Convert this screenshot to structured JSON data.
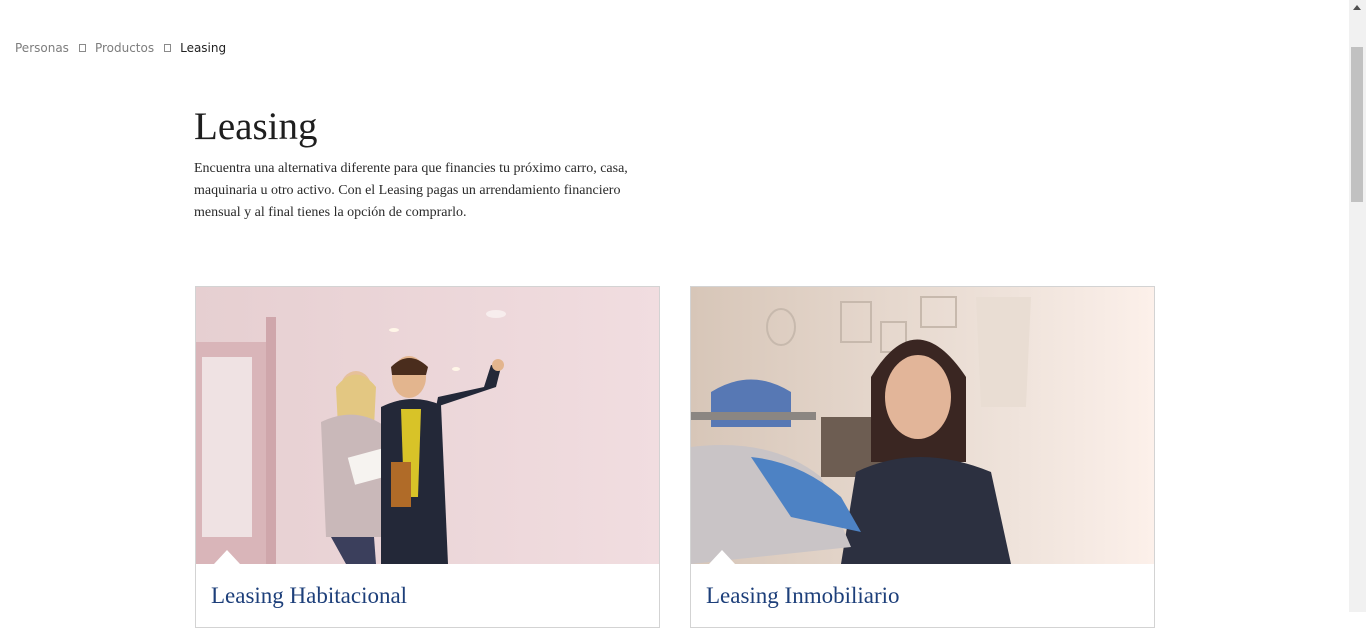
{
  "breadcrumb": {
    "items": [
      "Personas",
      "Productos"
    ],
    "current": "Leasing"
  },
  "header": {
    "title": "Leasing",
    "description": "Encuentra una alternativa diferente para que financies tu próximo carro, casa, maquinaria u otro activo. Con el Leasing pagas un arrendamiento financiero mensual y al final tienes la opción de comprarlo."
  },
  "cards": [
    {
      "title": "Leasing Habitacional",
      "image": "couple-viewing-house-photo"
    },
    {
      "title": "Leasing Inmobiliario",
      "image": "woman-in-shop-photo"
    }
  ],
  "colors": {
    "link": "#1d3f7a",
    "breadcrumb": "#7d7d7d"
  }
}
